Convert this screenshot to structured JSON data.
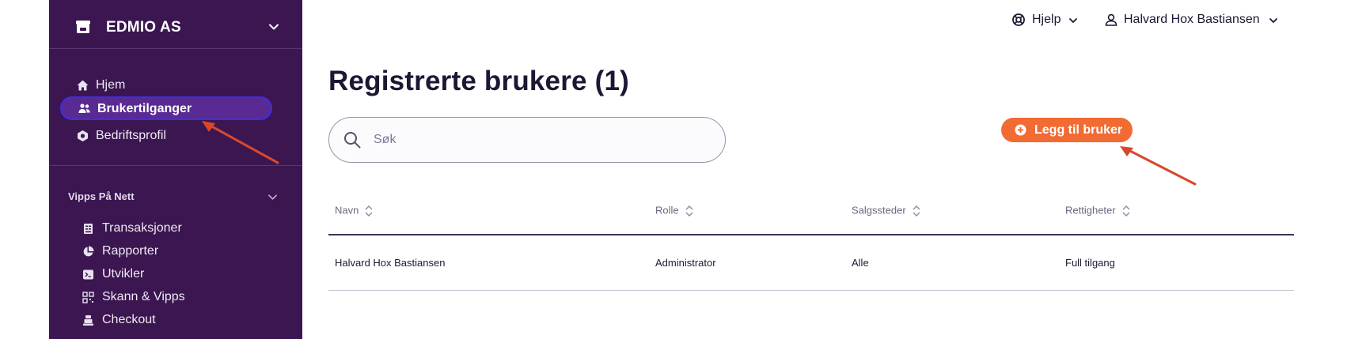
{
  "sidebar": {
    "org_name": "EDMIO AS",
    "nav": [
      {
        "label": "Hjem",
        "icon": "home-icon",
        "active": false
      },
      {
        "label": "Brukertilganger",
        "icon": "users-icon",
        "active": true
      },
      {
        "label": "Bedriftsprofil",
        "icon": "building-icon",
        "active": false
      }
    ],
    "section": {
      "title": "Vipps På Nett",
      "items": [
        {
          "label": "Transaksjoner",
          "icon": "receipt-icon"
        },
        {
          "label": "Rapporter",
          "icon": "pie-chart-icon"
        },
        {
          "label": "Utvikler",
          "icon": "terminal-icon"
        },
        {
          "label": "Skann & Vipps",
          "icon": "qr-code-icon"
        },
        {
          "label": "Checkout",
          "icon": "cash-register-icon"
        }
      ]
    }
  },
  "topbar": {
    "help_label": "Hjelp",
    "user_name": "Halvard Hox Bastiansen"
  },
  "main": {
    "title": "Registrerte brukere (1)",
    "search_placeholder": "Søk",
    "add_button_label": "Legg til bruker",
    "table": {
      "columns": [
        "Navn",
        "Rolle",
        "Salgssteder",
        "Rettigheter"
      ],
      "rows": [
        [
          "Halvard Hox Bastiansen",
          "Administrator",
          "Alle",
          "Full tilgang"
        ]
      ]
    }
  },
  "colors": {
    "sidebar_bg": "#3b1650",
    "active_item_bg": "#5a2a93",
    "active_item_border": "#3d2ee0",
    "primary_button": "#f26b33",
    "annotation_arrow": "#d9472b"
  }
}
